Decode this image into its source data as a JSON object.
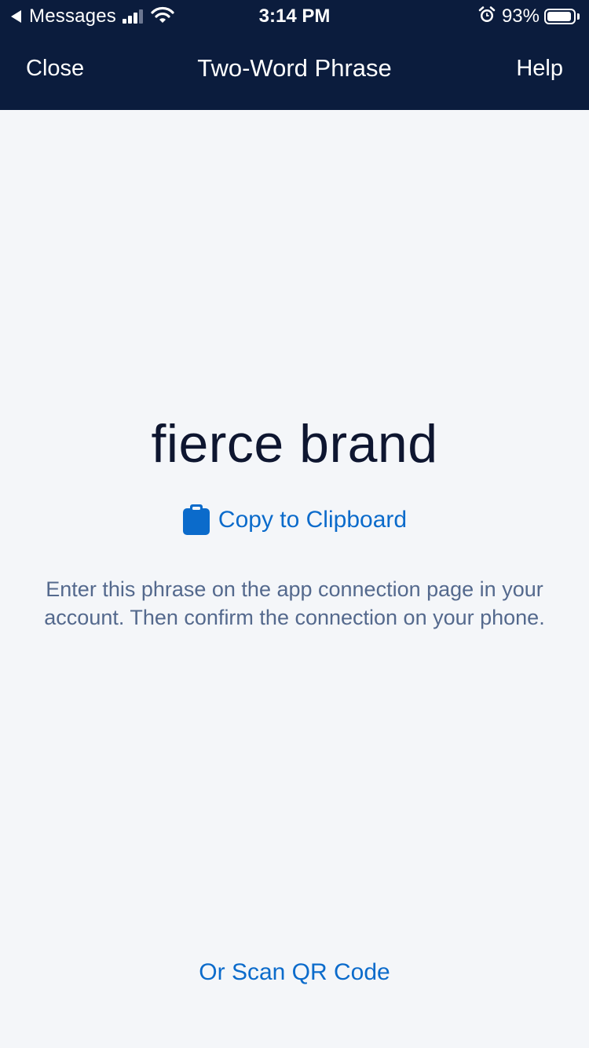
{
  "status_bar": {
    "back_app": "Messages",
    "time": "3:14 PM",
    "battery_percent": "93%",
    "battery_level": 0.93,
    "icons": [
      "signal-icon",
      "wifi-icon",
      "alarm-icon",
      "battery-icon"
    ]
  },
  "nav": {
    "close_label": "Close",
    "title": "Two-Word Phrase",
    "help_label": "Help"
  },
  "content": {
    "phrase": "fierce brand",
    "copy_label": "Copy to Clipboard",
    "copy_icon": "clipboard-icon",
    "instructions": "Enter this phrase on the app connection page in your account. Then confirm the connection on your phone.",
    "qr_label": "Or Scan QR Code"
  },
  "colors": {
    "header_bg": "#0b1c3d",
    "page_bg": "#f4f6f9",
    "link": "#0b6bcb",
    "phrase_text": "#0e1630",
    "body_text": "#54698d"
  }
}
